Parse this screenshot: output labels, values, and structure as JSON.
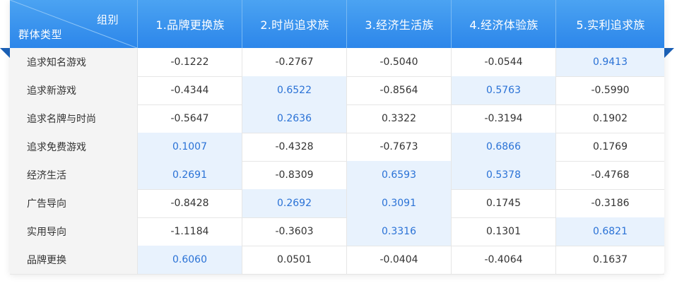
{
  "corner": {
    "top_right": "组别",
    "bottom_left": "群体类型"
  },
  "columns": [
    "1.品牌更换族",
    "2.时尚追求族",
    "3.经济生活族",
    "4.经济体验族",
    "5.实利追求族"
  ],
  "rows": [
    {
      "label": "追求知名游戏",
      "values": [
        "-0.1222",
        "-0.2767",
        "-0.5040",
        "-0.0544",
        "0.9413"
      ],
      "highlight": [
        false,
        false,
        false,
        false,
        true
      ]
    },
    {
      "label": "追求新游戏",
      "values": [
        "-0.4344",
        "0.6522",
        "-0.8564",
        "0.5763",
        "-0.5990"
      ],
      "highlight": [
        false,
        true,
        false,
        true,
        false
      ]
    },
    {
      "label": "追求名牌与时尚",
      "values": [
        "-0.5647",
        "0.2636",
        "0.3322",
        "-0.3194",
        "0.1902"
      ],
      "highlight": [
        false,
        true,
        false,
        false,
        false
      ]
    },
    {
      "label": "追求免费游戏",
      "values": [
        "0.1007",
        "-0.4328",
        "-0.7673",
        "0.6866",
        "0.1769"
      ],
      "highlight": [
        true,
        false,
        false,
        true,
        false
      ]
    },
    {
      "label": "经济生活",
      "values": [
        "0.2691",
        "-0.8309",
        "0.6593",
        "0.5378",
        "-0.4768"
      ],
      "highlight": [
        true,
        false,
        true,
        true,
        false
      ]
    },
    {
      "label": "广告导向",
      "values": [
        "-0.8428",
        "0.2692",
        "0.3091",
        "0.1745",
        "-0.3186"
      ],
      "highlight": [
        false,
        true,
        true,
        false,
        false
      ]
    },
    {
      "label": "实用导向",
      "values": [
        "-1.1184",
        "-0.3603",
        "0.3316",
        "0.1301",
        "0.6821"
      ],
      "highlight": [
        false,
        false,
        true,
        false,
        true
      ]
    },
    {
      "label": "品牌更换",
      "values": [
        "0.6060",
        "0.0501",
        "-0.0404",
        "-0.4064",
        "0.1637"
      ],
      "highlight": [
        true,
        false,
        false,
        false,
        false
      ]
    }
  ],
  "colors": {
    "header": "#2c86ea",
    "highlight_bg": "#e8f2fd",
    "highlight_text": "#2a72d6"
  }
}
